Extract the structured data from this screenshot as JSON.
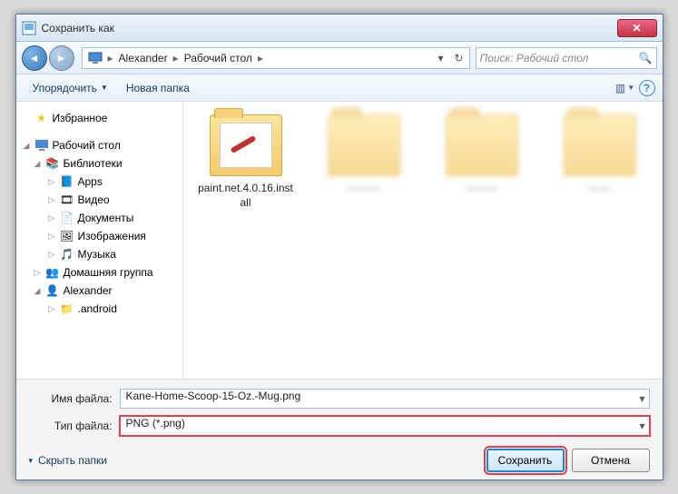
{
  "window": {
    "title": "Сохранить как"
  },
  "breadcrumb": {
    "segments": [
      "Alexander",
      "Рабочий стол"
    ]
  },
  "search": {
    "placeholder": "Поиск: Рабочий стол"
  },
  "toolbar": {
    "organize": "Упорядочить",
    "new_folder": "Новая папка"
  },
  "sidebar": {
    "favorites": "Избранное",
    "desktop": "Рабочий стол",
    "libraries": "Библиотеки",
    "apps": "Apps",
    "video": "Видео",
    "documents": "Документы",
    "pictures": "Изображения",
    "music": "Музыка",
    "homegroup": "Домашняя группа",
    "user": "Alexander",
    "android": ".android"
  },
  "files": {
    "item1": "paint.net.4.0.16.install"
  },
  "fields": {
    "filename_label": "Имя файла:",
    "filename_value": "Kane-Home-Scoop-15-Oz.-Mug.png",
    "filetype_label": "Тип файла:",
    "filetype_value": "PNG (*.png)"
  },
  "buttons": {
    "hide_folders": "Скрыть папки",
    "save": "Сохранить",
    "cancel": "Отмена"
  }
}
